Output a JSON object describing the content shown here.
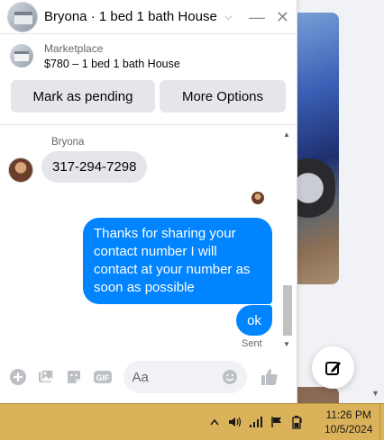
{
  "chat": {
    "title": "Bryona · 1 bed 1 bath House",
    "listing": {
      "category": "Marketplace",
      "price_title": "$780 – 1 bed 1 bath House"
    },
    "buttons": {
      "mark_pending": "Mark as pending",
      "more_options": "More Options"
    },
    "messages": {
      "sender_name": "Bryona",
      "incoming_text": "317-294-7298",
      "outgoing_1": "Thanks for sharing your contact number I will contact at your number as soon as possible",
      "outgoing_2": "ok",
      "status": "Sent"
    },
    "composer": {
      "placeholder": "Aa"
    }
  },
  "taskbar": {
    "time": "11:26 PM",
    "date": "10/5/2024"
  },
  "colors": {
    "accent": "#0084ff",
    "taskbar": "#d9b25a"
  }
}
